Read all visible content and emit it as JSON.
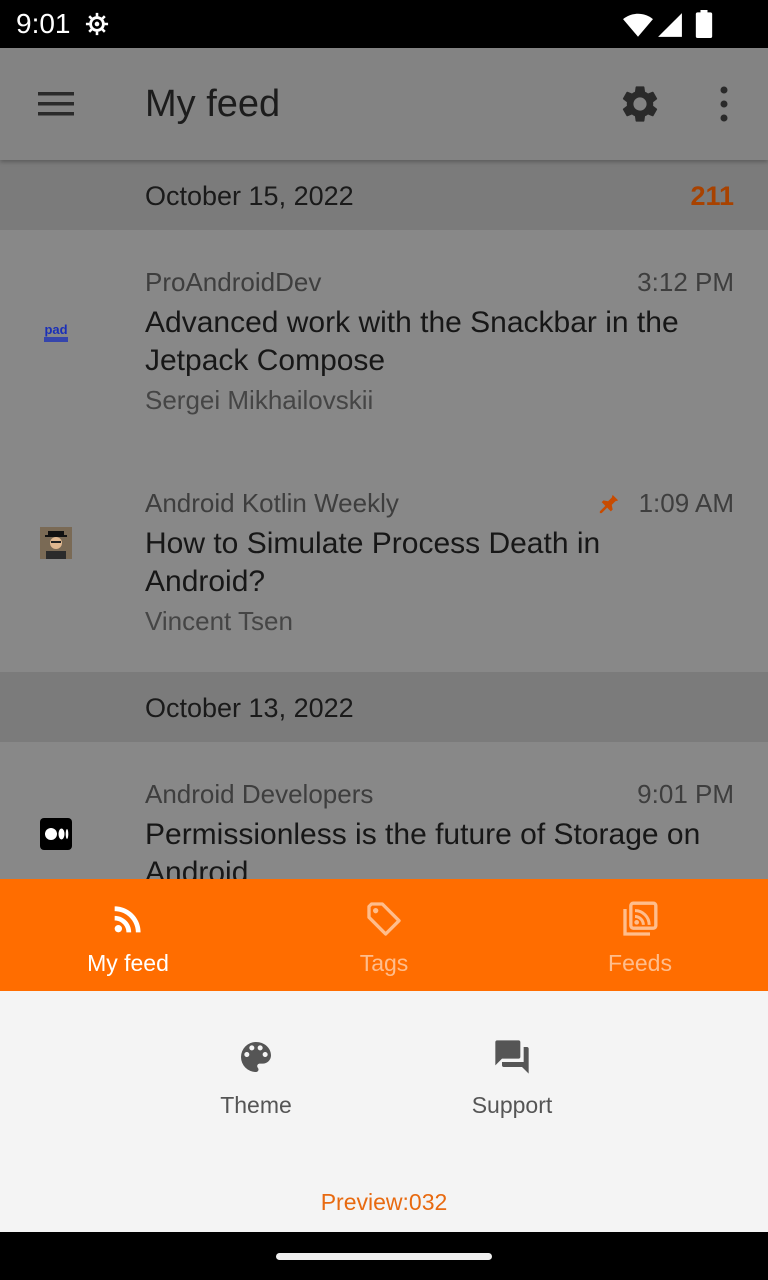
{
  "status_bar": {
    "time": "9:01",
    "icons": [
      "settings-gear-icon",
      "wifi-icon",
      "signal-icon",
      "battery-icon"
    ]
  },
  "app_bar": {
    "title": "My feed",
    "icons": [
      "hamburger-menu-icon",
      "settings-icon",
      "more-vert-icon"
    ]
  },
  "feed": {
    "sections": [
      {
        "date": "October 15, 2022",
        "count": "211"
      },
      {
        "date": "October 13, 2022",
        "count": ""
      }
    ],
    "items": [
      {
        "source": "ProAndroidDev",
        "time": "3:12 PM",
        "title": "Advanced work with the Snackbar in the Jetpack Compose",
        "author": "Sergei Mikhailovskii",
        "logo": "proandroiddev-logo",
        "pinned": false
      },
      {
        "source": "Android Kotlin Weekly",
        "time": "1:09 AM",
        "title": "How to Simulate Process Death in Android?",
        "author": "Vincent Tsen",
        "logo": "avatar-logo",
        "pinned": true
      },
      {
        "source": "Android Developers",
        "time": "9:01 PM",
        "title": "Permissionless is the future of Storage on Android",
        "author": "",
        "logo": "medium-logo",
        "pinned": false
      }
    ]
  },
  "bottom_nav": {
    "items": [
      {
        "label": "My feed",
        "icon": "rss-icon",
        "active": true
      },
      {
        "label": "Tags",
        "icon": "tag-icon",
        "active": false
      },
      {
        "label": "Feeds",
        "icon": "feeds-library-icon",
        "active": false
      }
    ]
  },
  "sheet": {
    "options": [
      {
        "label": "Theme",
        "icon": "palette-icon"
      },
      {
        "label": "Support",
        "icon": "forum-icon"
      }
    ],
    "preview": "Preview:032"
  },
  "colors": {
    "accent": "#ff6d00",
    "count": "#a84200",
    "preview": "#e86a10",
    "pin": "#c84b00"
  }
}
